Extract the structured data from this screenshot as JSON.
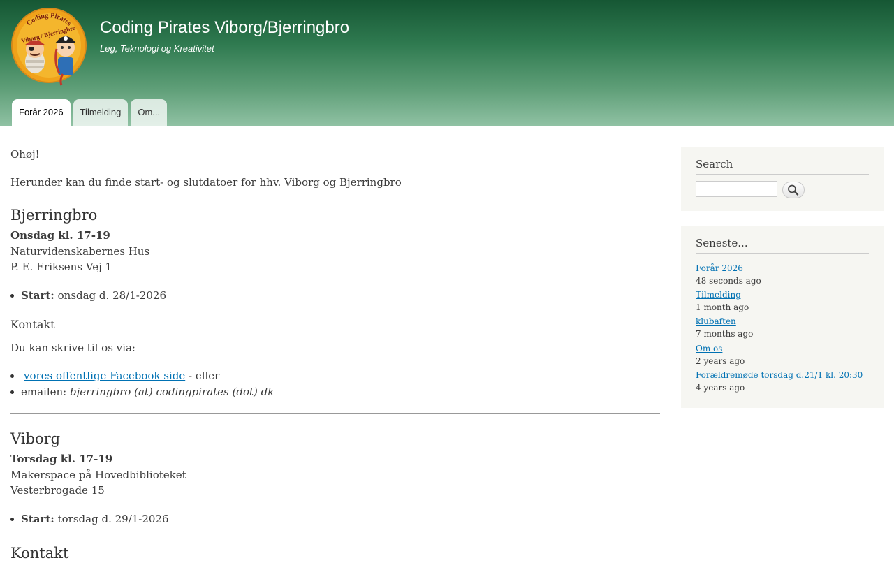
{
  "header": {
    "site_name": "Coding Pirates Viborg/Bjerringbro",
    "slogan": "Leg, Teknologi og Kreativitet",
    "logo": {
      "top_text": "Coding Pirates",
      "middle_text": "Viborg / Bjerringbro"
    }
  },
  "menu": {
    "items": [
      {
        "label": "Forår 2026",
        "active": true
      },
      {
        "label": "Tilmelding",
        "active": false
      },
      {
        "label": "Om...",
        "active": false
      }
    ]
  },
  "content": {
    "greeting": "Ohøj!",
    "intro": "Herunder kan du finde start- og slutdatoer for hhv. Viborg og Bjerringbro",
    "bjerringbro": {
      "heading": "Bjerringbro",
      "time": "Onsdag kl. 17-19",
      "place": "Naturvidenskabernes Hus",
      "address": "P. E. Eriksens Vej 1",
      "start_label": "Start:",
      "start_value": " onsdag d. 28/1-2026",
      "contact_heading": "Kontakt",
      "contact_intro": "Du kan skrive til os via:",
      "facebook_link": "vores offentlige Facebook side",
      "facebook_suffix": " - eller",
      "email_label": "emailen: ",
      "email_value": "bjerringbro (at) codingpirates (dot) dk"
    },
    "viborg": {
      "heading": "Viborg",
      "time": "Torsdag kl. 17-19",
      "place": "Makerspace på Hovedbiblioteket",
      "address": "Vesterbrogade 15",
      "start_label": "Start:",
      "start_value": " torsdag d. 29/1-2026",
      "contact_heading": "Kontakt"
    }
  },
  "sidebar": {
    "search": {
      "title": "Search",
      "placeholder": ""
    },
    "recent": {
      "title": "Seneste...",
      "items": [
        {
          "title": "Forår 2026",
          "ago": "48 seconds ago"
        },
        {
          "title": "Tilmelding",
          "ago": "1 month ago"
        },
        {
          "title": "klubaften",
          "ago": "7 months ago"
        },
        {
          "title": "Om os",
          "ago": "2 years ago"
        },
        {
          "title": "Forældremøde torsdag d.21/1 kl. 20:30",
          "ago": "4 years ago"
        }
      ]
    }
  },
  "colors": {
    "header_top": "#165734",
    "header_bottom": "#8fc1a3",
    "link": "#0071b3",
    "sidebar_bg": "#f6f6f2"
  }
}
